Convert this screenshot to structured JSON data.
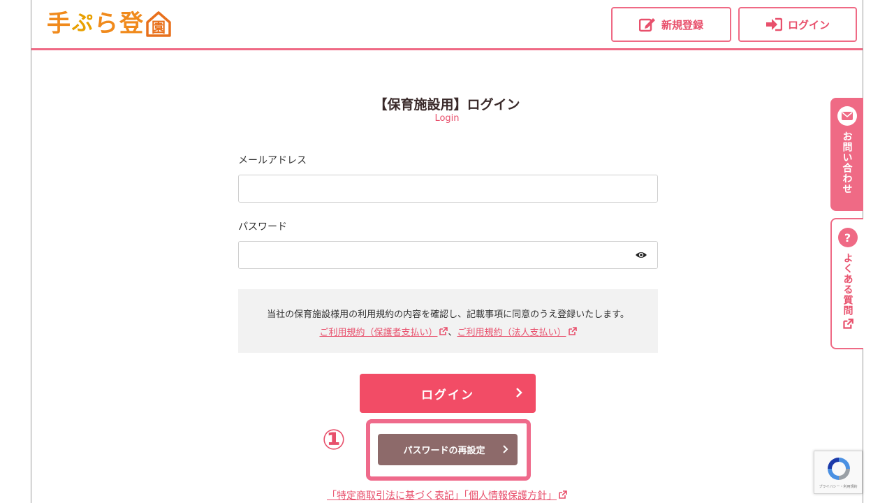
{
  "header": {
    "logo_chars": [
      "手",
      "ぷ",
      "ら",
      "登"
    ],
    "logo_house_char": "園",
    "register_label": "新規登録",
    "login_label": "ログイン"
  },
  "main": {
    "title": "【保育施設用】ログイン",
    "subtitle": "Login",
    "email_label": "メールアドレス",
    "email_value": "",
    "password_label": "パスワード",
    "password_value": "",
    "terms_text": "当社の保育施設様用の利用規約の内容を確認し、記載事項に同意のうえ登録いたします。",
    "terms_link1": "ご利用規約（保護者支払い）",
    "terms_sep": "、",
    "terms_link2": "ご利用規約（法人支払い）",
    "login_button": "ログイン",
    "annotation_number": "①",
    "reset_button": "パスワードの再設定"
  },
  "footer": {
    "link1": "「特定商取引法に基づく表記」",
    "link2": "「個人情報保護方針」"
  },
  "side": {
    "contact_label": "お問い合わせ",
    "faq_icon": "?",
    "faq_label": "よくある質問"
  },
  "recaptcha": {
    "text": "プライバシー・利用規約"
  },
  "colors": {
    "accent": "#ef6a85",
    "primary_button": "#f24c66",
    "reset_button": "#8d6a6a",
    "logo_orange": "#f08a1c"
  }
}
